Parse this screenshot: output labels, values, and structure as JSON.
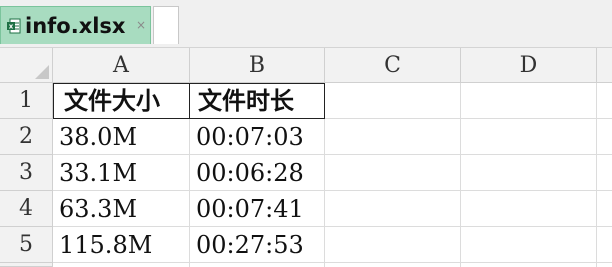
{
  "tab": {
    "title": "info.xlsx",
    "close": "×",
    "icon": "excel-file-icon",
    "accent": "#a8dcc0"
  },
  "columns": [
    "A",
    "B",
    "C",
    "D"
  ],
  "rows": [
    "1",
    "2",
    "3",
    "4",
    "5"
  ],
  "cells": [
    [
      "文件大小",
      "文件时长",
      "",
      ""
    ],
    [
      "38.0M",
      "00:07:03",
      "",
      ""
    ],
    [
      "33.1M",
      "00:06:28",
      "",
      ""
    ],
    [
      "63.3M",
      "00:07:41",
      "",
      ""
    ],
    [
      "115.8M",
      "00:27:53",
      "",
      ""
    ]
  ]
}
